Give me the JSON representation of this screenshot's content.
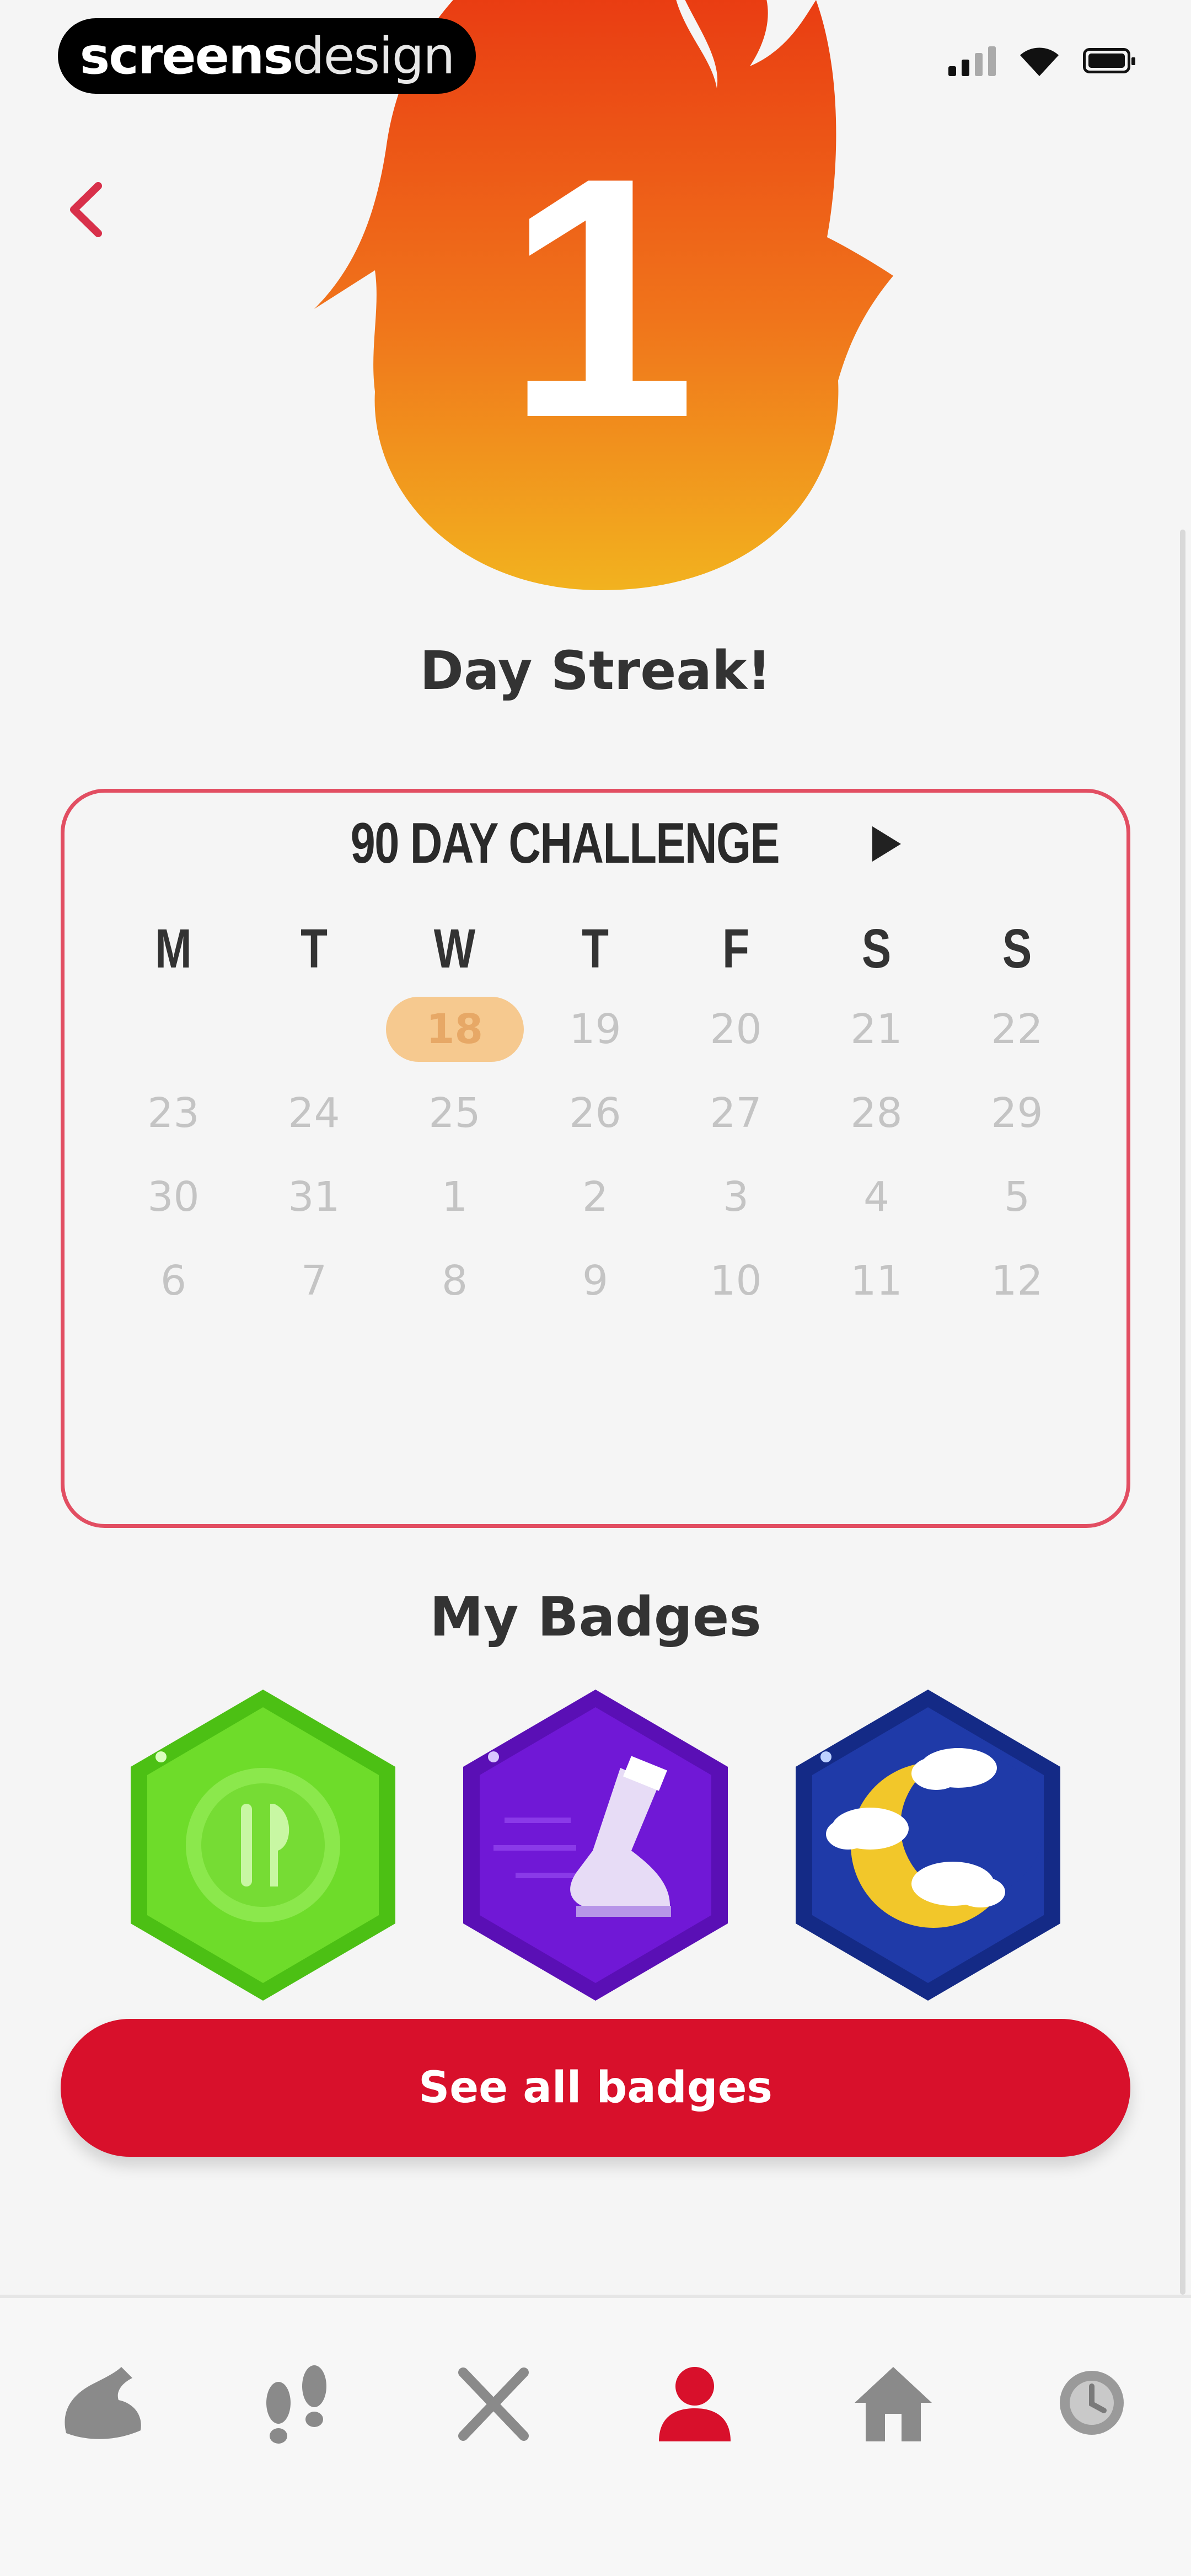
{
  "status_bar": {
    "watermark_bold": "screens",
    "watermark_light": "design"
  },
  "streak": {
    "count": "1",
    "label": "Day Streak!"
  },
  "challenge": {
    "title": "90 DAY CHALLENGE",
    "weekdays": [
      "M",
      "T",
      "W",
      "T",
      "F",
      "S",
      "S"
    ],
    "weeks": [
      [
        "",
        "",
        "18",
        "19",
        "20",
        "21",
        "22"
      ],
      [
        "23",
        "24",
        "25",
        "26",
        "27",
        "28",
        "29"
      ],
      [
        "30",
        "31",
        "1",
        "2",
        "3",
        "4",
        "5"
      ],
      [
        "6",
        "7",
        "8",
        "9",
        "10",
        "11",
        "12"
      ]
    ],
    "highlighted_day": "18"
  },
  "badges": {
    "title": "My Badges",
    "items": [
      {
        "name": "fork-knife-badge",
        "color": "#5ed51f"
      },
      {
        "name": "running-shoe-badge",
        "color": "#6a10c9"
      },
      {
        "name": "moon-cloud-badge",
        "color": "#1a2f9a"
      }
    ],
    "see_all_label": "See all badges"
  },
  "tab_bar": {
    "items": [
      {
        "icon": "muscle-arm-icon",
        "active": false
      },
      {
        "icon": "footsteps-icon",
        "active": false
      },
      {
        "icon": "fork-knife-icon",
        "active": false
      },
      {
        "icon": "profile-icon",
        "active": true
      },
      {
        "icon": "home-icon",
        "active": false
      },
      {
        "icon": "clock-icon",
        "active": false
      }
    ]
  },
  "colors": {
    "accent": "#d8102b",
    "card_border": "#e24e62",
    "today_highlight": "#f6c98f",
    "flame_top": "#e93a12",
    "flame_bottom": "#f2b21f"
  }
}
